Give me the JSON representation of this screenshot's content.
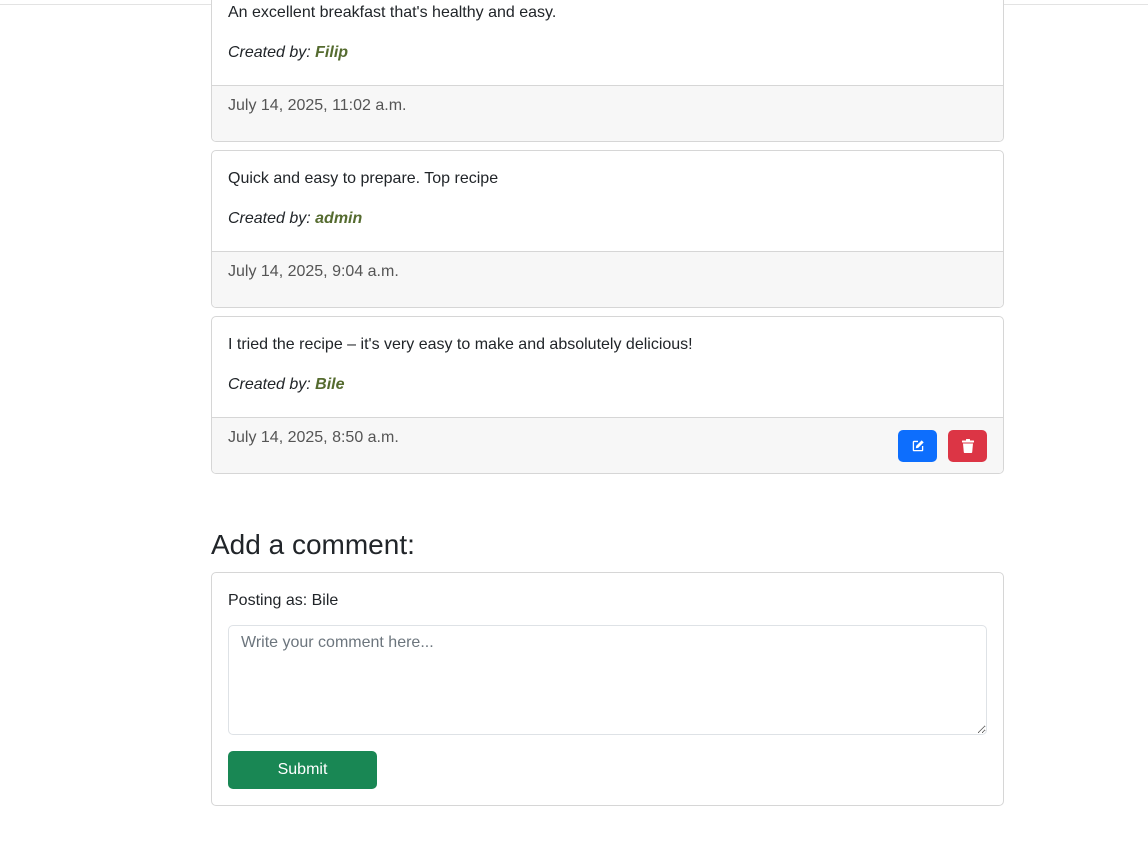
{
  "comments": [
    {
      "text": "An excellent breakfast that's healthy and easy.",
      "created_label": "Created by: ",
      "author": "Filip",
      "timestamp": "July 14, 2025, 11:02 a.m.",
      "has_actions": false
    },
    {
      "text": "Quick and easy to prepare. Top recipe",
      "created_label": "Created by: ",
      "author": "admin",
      "timestamp": "July 14, 2025, 9:04 a.m.",
      "has_actions": false
    },
    {
      "text": "I tried the recipe – it's very easy to make and absolutely delicious!",
      "created_label": "Created by: ",
      "author": "Bile",
      "timestamp": "July 14, 2025, 8:50 a.m.",
      "has_actions": true,
      "actions": {
        "edit_icon": "edit-icon",
        "delete_icon": "trash-icon"
      }
    }
  ],
  "add_comment": {
    "heading": "Add a comment:",
    "posting_as": "Posting as: Bile",
    "placeholder": "Write your comment here...",
    "value": "",
    "submit_label": "Submit"
  },
  "colors": {
    "author": "#556b2f",
    "edit": "#0d6efd",
    "delete": "#dc3545",
    "submit": "#198754"
  }
}
